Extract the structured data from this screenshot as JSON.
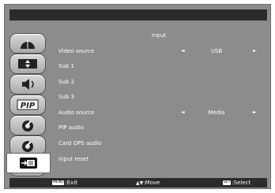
{
  "panel": {
    "title": "Input"
  },
  "rows": [
    {
      "label": "Video source",
      "value": "USB",
      "left_arrow": "◄",
      "right_arrow": "►"
    },
    {
      "label": "Sub 1"
    },
    {
      "label": "Sub 2"
    },
    {
      "label": "Sub 3"
    },
    {
      "label": "Audio source",
      "value": "Media",
      "left_arrow": "◄",
      "right_arrow": "►"
    },
    {
      "label": "PIP audio"
    },
    {
      "label": "Card OPS audio"
    },
    {
      "label": "Input reset"
    }
  ],
  "sidebar": {
    "items": [
      {
        "icon": "picture-icon"
      },
      {
        "icon": "screen-icon"
      },
      {
        "icon": "audio-icon"
      },
      {
        "icon": "pip-icon",
        "label": "PIP"
      },
      {
        "icon": "config1-icon"
      },
      {
        "icon": "config2-icon"
      },
      {
        "icon": "advanced-icon"
      },
      {
        "icon": "input-icon",
        "selected": true
      }
    ]
  },
  "footer": {
    "exit_key": "MENU",
    "exit_label": ":Exit",
    "move_key": "▲▼",
    "move_label": ":Move",
    "select_key": "SET",
    "select_label": ":Select"
  },
  "colors": {
    "background": "#8c8c8c",
    "bar": "#2b2b2b",
    "text": "#ffffff"
  }
}
